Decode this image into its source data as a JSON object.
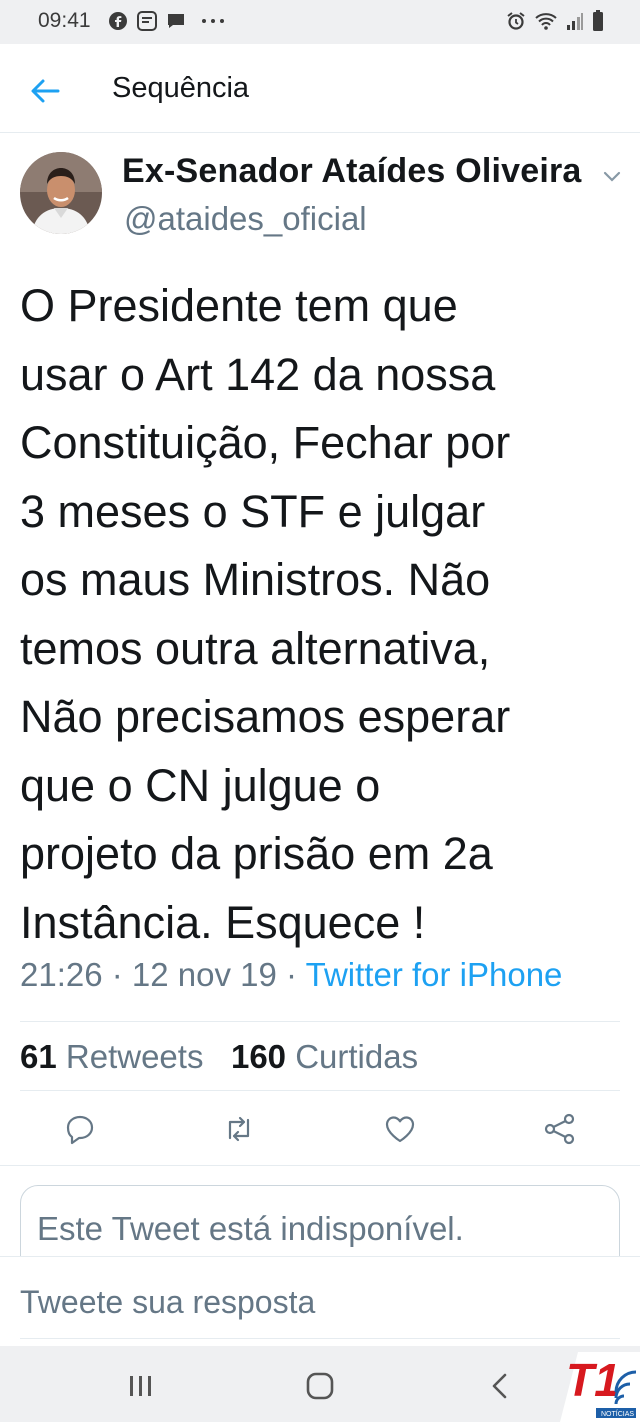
{
  "status_bar": {
    "time": "09:41",
    "left_icons": [
      "facebook-icon",
      "messenger-icon",
      "chat-icon",
      "more-dots-icon"
    ],
    "right_icons": [
      "alarm-icon",
      "wifi-icon",
      "signal-icon",
      "battery-icon"
    ]
  },
  "header": {
    "title": "Sequência"
  },
  "tweet": {
    "author_name": "Ex-Senador Ataídes Oliveira",
    "handle": "@ataides_oficial",
    "lines": [
      "O Presidente tem que",
      "usar o Art 142 da nossa",
      "Constituição, Fechar por",
      "3 meses o STF e julgar",
      "os maus Ministros. Não",
      "temos outra alternativa,",
      "Não precisamos esperar",
      "que o CN julgue o",
      "projeto da prisão em 2a",
      "Instância. Esquece !"
    ],
    "time": "21:26",
    "date": "12 nov 19",
    "source": "Twitter for iPhone",
    "retweets_count": "61",
    "retweets_label": "Retweets",
    "likes_count": "160",
    "likes_label": "Curtidas"
  },
  "actions": [
    "reply-icon",
    "retweet-icon",
    "like-icon",
    "share-icon"
  ],
  "unavailable_notice": "Este Tweet está indisponível.",
  "reply_placeholder": "Tweete sua resposta",
  "colors": {
    "accent": "#1da1f2",
    "secondary_text": "#657786",
    "watermark_red": "#d7191f"
  }
}
